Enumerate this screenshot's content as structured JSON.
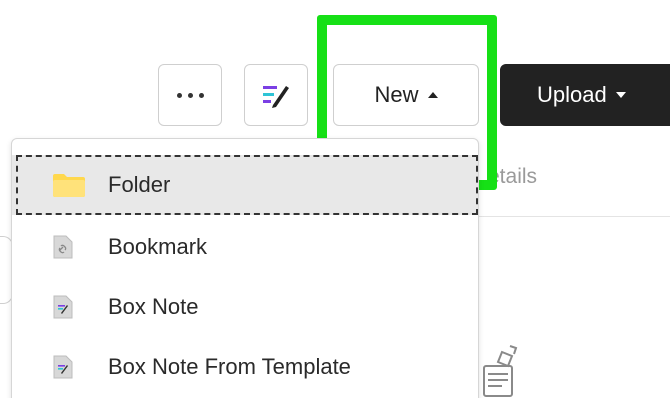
{
  "toolbar": {
    "more_icon": "more-dots-icon",
    "note_icon": "box-note-pen-icon",
    "new_label": "New",
    "upload_label": "Upload"
  },
  "background": {
    "tab_partial": "etails"
  },
  "new_menu": {
    "items": [
      {
        "label": "Folder",
        "icon": "folder-icon"
      },
      {
        "label": "Bookmark",
        "icon": "bookmark-icon"
      },
      {
        "label": "Box Note",
        "icon": "box-note-icon"
      },
      {
        "label": "Box Note From Template",
        "icon": "box-note-template-icon"
      }
    ]
  },
  "colors": {
    "highlight": "#16e016",
    "upload_bg": "#222222",
    "folder": "#ffd84d",
    "note_purple": "#7b3fe4",
    "note_cyan": "#2ec4d6"
  }
}
